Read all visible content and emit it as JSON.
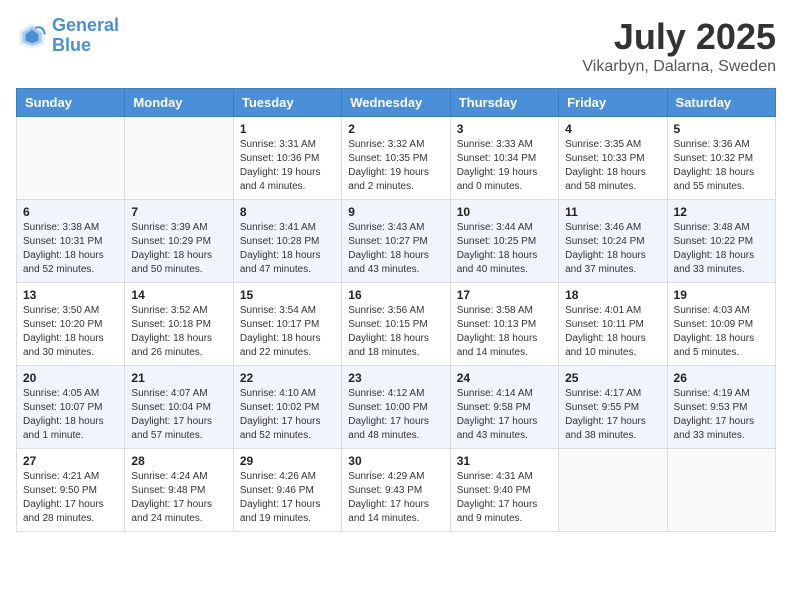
{
  "logo": {
    "line1": "General",
    "line2": "Blue"
  },
  "header": {
    "month": "July 2025",
    "location": "Vikarbyn, Dalarna, Sweden"
  },
  "weekdays": [
    "Sunday",
    "Monday",
    "Tuesday",
    "Wednesday",
    "Thursday",
    "Friday",
    "Saturday"
  ],
  "weeks": [
    [
      {
        "day": "",
        "info": ""
      },
      {
        "day": "",
        "info": ""
      },
      {
        "day": "1",
        "info": "Sunrise: 3:31 AM\nSunset: 10:36 PM\nDaylight: 19 hours\nand 4 minutes."
      },
      {
        "day": "2",
        "info": "Sunrise: 3:32 AM\nSunset: 10:35 PM\nDaylight: 19 hours\nand 2 minutes."
      },
      {
        "day": "3",
        "info": "Sunrise: 3:33 AM\nSunset: 10:34 PM\nDaylight: 19 hours\nand 0 minutes."
      },
      {
        "day": "4",
        "info": "Sunrise: 3:35 AM\nSunset: 10:33 PM\nDaylight: 18 hours\nand 58 minutes."
      },
      {
        "day": "5",
        "info": "Sunrise: 3:36 AM\nSunset: 10:32 PM\nDaylight: 18 hours\nand 55 minutes."
      }
    ],
    [
      {
        "day": "6",
        "info": "Sunrise: 3:38 AM\nSunset: 10:31 PM\nDaylight: 18 hours\nand 52 minutes."
      },
      {
        "day": "7",
        "info": "Sunrise: 3:39 AM\nSunset: 10:29 PM\nDaylight: 18 hours\nand 50 minutes."
      },
      {
        "day": "8",
        "info": "Sunrise: 3:41 AM\nSunset: 10:28 PM\nDaylight: 18 hours\nand 47 minutes."
      },
      {
        "day": "9",
        "info": "Sunrise: 3:43 AM\nSunset: 10:27 PM\nDaylight: 18 hours\nand 43 minutes."
      },
      {
        "day": "10",
        "info": "Sunrise: 3:44 AM\nSunset: 10:25 PM\nDaylight: 18 hours\nand 40 minutes."
      },
      {
        "day": "11",
        "info": "Sunrise: 3:46 AM\nSunset: 10:24 PM\nDaylight: 18 hours\nand 37 minutes."
      },
      {
        "day": "12",
        "info": "Sunrise: 3:48 AM\nSunset: 10:22 PM\nDaylight: 18 hours\nand 33 minutes."
      }
    ],
    [
      {
        "day": "13",
        "info": "Sunrise: 3:50 AM\nSunset: 10:20 PM\nDaylight: 18 hours\nand 30 minutes."
      },
      {
        "day": "14",
        "info": "Sunrise: 3:52 AM\nSunset: 10:18 PM\nDaylight: 18 hours\nand 26 minutes."
      },
      {
        "day": "15",
        "info": "Sunrise: 3:54 AM\nSunset: 10:17 PM\nDaylight: 18 hours\nand 22 minutes."
      },
      {
        "day": "16",
        "info": "Sunrise: 3:56 AM\nSunset: 10:15 PM\nDaylight: 18 hours\nand 18 minutes."
      },
      {
        "day": "17",
        "info": "Sunrise: 3:58 AM\nSunset: 10:13 PM\nDaylight: 18 hours\nand 14 minutes."
      },
      {
        "day": "18",
        "info": "Sunrise: 4:01 AM\nSunset: 10:11 PM\nDaylight: 18 hours\nand 10 minutes."
      },
      {
        "day": "19",
        "info": "Sunrise: 4:03 AM\nSunset: 10:09 PM\nDaylight: 18 hours\nand 5 minutes."
      }
    ],
    [
      {
        "day": "20",
        "info": "Sunrise: 4:05 AM\nSunset: 10:07 PM\nDaylight: 18 hours\nand 1 minute."
      },
      {
        "day": "21",
        "info": "Sunrise: 4:07 AM\nSunset: 10:04 PM\nDaylight: 17 hours\nand 57 minutes."
      },
      {
        "day": "22",
        "info": "Sunrise: 4:10 AM\nSunset: 10:02 PM\nDaylight: 17 hours\nand 52 minutes."
      },
      {
        "day": "23",
        "info": "Sunrise: 4:12 AM\nSunset: 10:00 PM\nDaylight: 17 hours\nand 48 minutes."
      },
      {
        "day": "24",
        "info": "Sunrise: 4:14 AM\nSunset: 9:58 PM\nDaylight: 17 hours\nand 43 minutes."
      },
      {
        "day": "25",
        "info": "Sunrise: 4:17 AM\nSunset: 9:55 PM\nDaylight: 17 hours\nand 38 minutes."
      },
      {
        "day": "26",
        "info": "Sunrise: 4:19 AM\nSunset: 9:53 PM\nDaylight: 17 hours\nand 33 minutes."
      }
    ],
    [
      {
        "day": "27",
        "info": "Sunrise: 4:21 AM\nSunset: 9:50 PM\nDaylight: 17 hours\nand 28 minutes."
      },
      {
        "day": "28",
        "info": "Sunrise: 4:24 AM\nSunset: 9:48 PM\nDaylight: 17 hours\nand 24 minutes."
      },
      {
        "day": "29",
        "info": "Sunrise: 4:26 AM\nSunset: 9:46 PM\nDaylight: 17 hours\nand 19 minutes."
      },
      {
        "day": "30",
        "info": "Sunrise: 4:29 AM\nSunset: 9:43 PM\nDaylight: 17 hours\nand 14 minutes."
      },
      {
        "day": "31",
        "info": "Sunrise: 4:31 AM\nSunset: 9:40 PM\nDaylight: 17 hours\nand 9 minutes."
      },
      {
        "day": "",
        "info": ""
      },
      {
        "day": "",
        "info": ""
      }
    ]
  ]
}
